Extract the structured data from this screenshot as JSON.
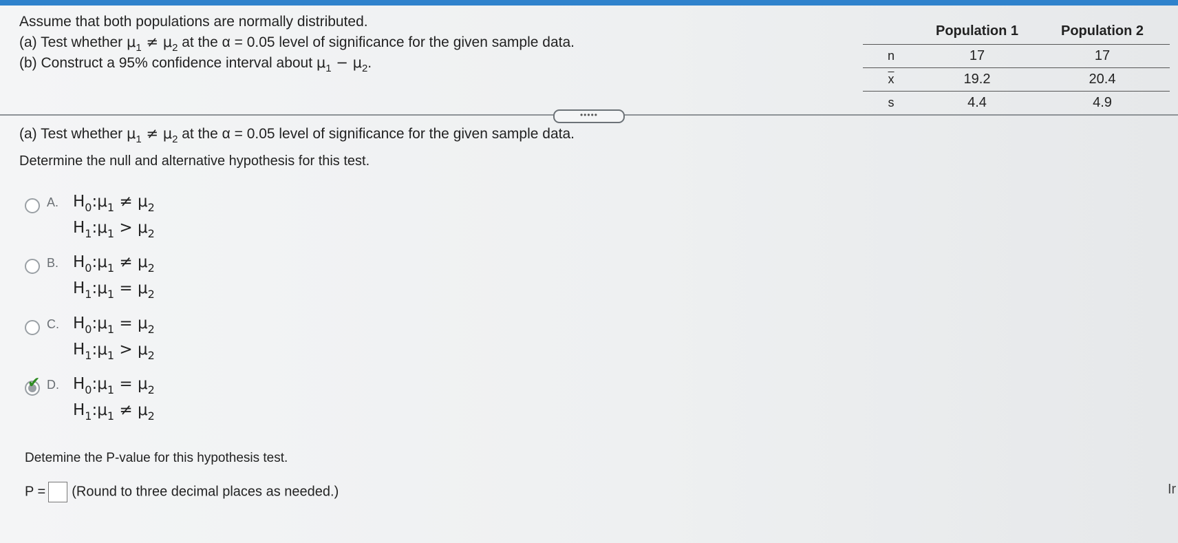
{
  "intro": {
    "line1": "Assume that both populations are normally distributed.",
    "part_a": {
      "prefix": "(a) Test whether ",
      "mu": "μ",
      "sub1": "1",
      "neq": " ≠ ",
      "sub2": "2",
      "suffix": " at the α = 0.05 level of significance for the given sample data."
    },
    "part_b": {
      "prefix": "(b) Construct a 95% confidence interval about ",
      "mu": "μ",
      "sub1": "1",
      "minus": " − ",
      "sub2": "2",
      "suffix": "."
    }
  },
  "table": {
    "headers": [
      "",
      "Population 1",
      "Population 2"
    ],
    "rows": [
      {
        "label": "n",
        "p1": "17",
        "p2": "17"
      },
      {
        "label": "x",
        "p1": "19.2",
        "p2": "20.4"
      },
      {
        "label": "s",
        "p1": "4.4",
        "p2": "4.9"
      }
    ]
  },
  "collapse_label": "•••••",
  "question_a": {
    "prefix": "(a) Test whether ",
    "mu": "μ",
    "sub1": "1",
    "neq": " ≠ ",
    "sub2": "2",
    "suffix": " at the α = 0.05 level of significance for the given sample data.",
    "instruction": "Determine the null and alternative hypothesis for this test."
  },
  "options": [
    {
      "letter": "A.",
      "h0_rel": " ≠ ",
      "h1_rel": " > ",
      "selected": false
    },
    {
      "letter": "B.",
      "h0_rel": " ≠ ",
      "h1_rel": " = ",
      "selected": false
    },
    {
      "letter": "C.",
      "h0_rel": " = ",
      "h1_rel": " > ",
      "selected": false
    },
    {
      "letter": "D.",
      "h0_rel": " = ",
      "h1_rel": " ≠ ",
      "selected": true
    }
  ],
  "hyp_symbols": {
    "H": "H",
    "h0_sub": "0",
    "h1_sub": "1",
    "colon": ":",
    "mu": "μ",
    "mu_sub1": "1",
    "mu_sub2": "2"
  },
  "check_mark": "✔",
  "pvalue": {
    "prompt": "Detemine the P-value for this hypothesis test.",
    "label": "P =",
    "input_value": "",
    "note": "(Round to three decimal places as needed.)"
  },
  "edge_text": "Ir"
}
